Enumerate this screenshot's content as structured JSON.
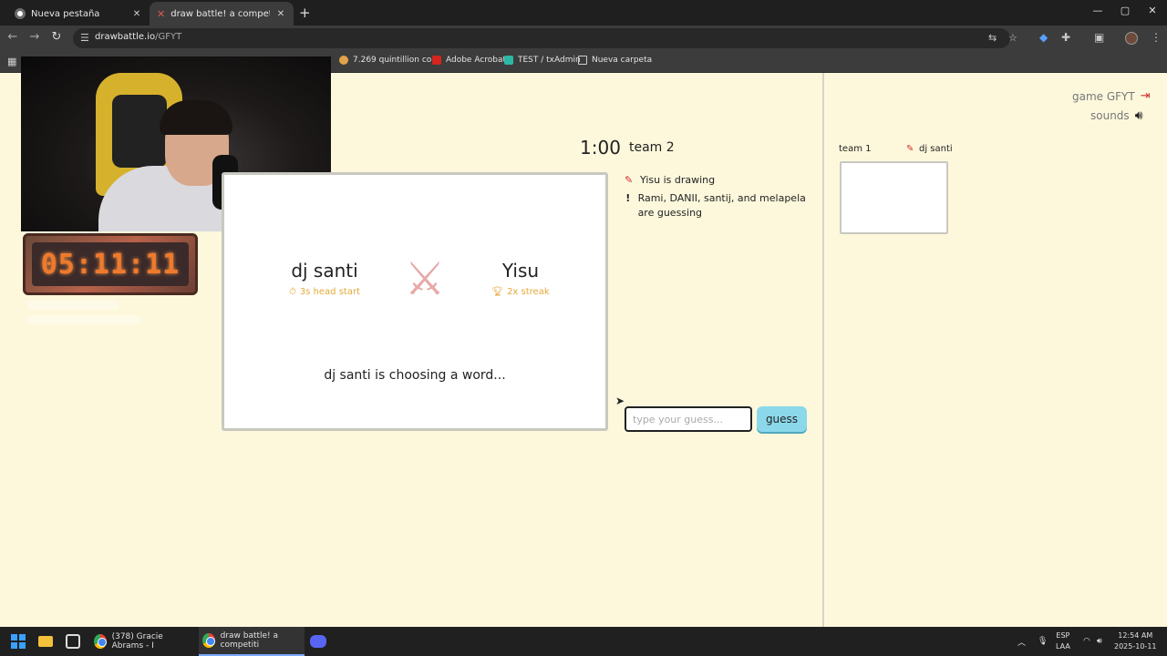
{
  "browser": {
    "tabs": [
      {
        "label": "Nueva pestaña"
      },
      {
        "label": "draw battle! a competitive team"
      }
    ],
    "new_tab": "+",
    "window_controls": {
      "minimize": "—",
      "maximize": "▢",
      "close": "✕"
    },
    "url": {
      "host": "drawbattle.io",
      "path": "/GFYT"
    },
    "bookmarks": [
      {
        "label": "7.269 quintillion co..."
      },
      {
        "label": "Adobe Acrobat"
      },
      {
        "label": "TEST / txAdmin"
      },
      {
        "label": "Nueva carpeta"
      }
    ]
  },
  "overlay": {
    "stream_timer": "05:11:11"
  },
  "game": {
    "game_code_label": "game GFYT",
    "sounds_label": "sounds",
    "round_timer": "1:00",
    "team_label": "team 2",
    "status": {
      "drawing": "Yisu is drawing",
      "guessing": "Rami, DANII, santij, and melapela are guessing"
    },
    "players": [
      {
        "name": "dj santi",
        "sub": "3s head start",
        "icon": "stopwatch-icon"
      },
      {
        "name": "Yisu",
        "sub": "2x streak",
        "icon": "trophy-icon"
      }
    ],
    "choosing_text": "dj santi is choosing a word...",
    "guess_placeholder": "type your guess...",
    "guess_button": "guess",
    "sidebar": {
      "team": "team 1",
      "player": "dj santi"
    },
    "colors": {
      "accent_red": "#d0302a",
      "button": "#8ad8ea",
      "gold": "#e4a93a"
    }
  },
  "taskbar": {
    "apps": [
      {
        "label": "(378) Gracie Abrams - I"
      },
      {
        "label": "draw battle! a competiti"
      }
    ],
    "lang": {
      "line1": "ESP",
      "line2": "LAA"
    },
    "clock": {
      "time": "12:54 AM",
      "date": "2025-10-11"
    }
  }
}
